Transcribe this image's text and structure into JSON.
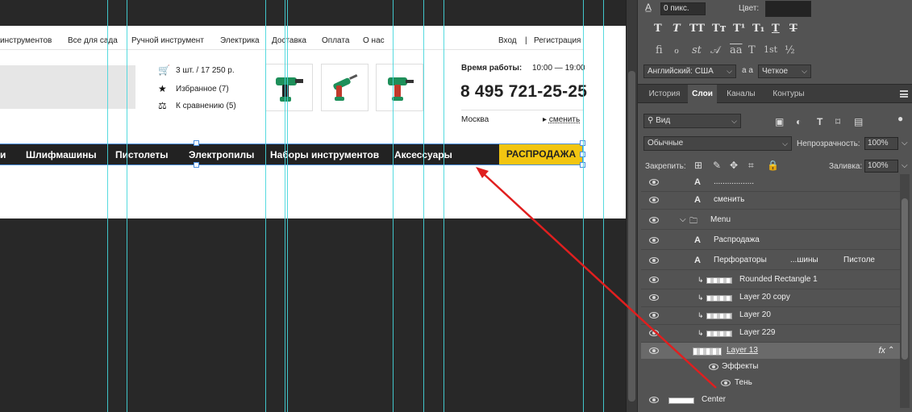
{
  "page": {
    "topnav": [
      "инструментов",
      "Все для сада",
      "Ручной инструмент",
      "Электрика",
      "Доставка",
      "Оплата",
      "О нас"
    ],
    "login": "Вход",
    "login_sep": "|",
    "register": "Регистрация",
    "cart": "3 шт. /  17 250 р.",
    "favorites": "Избранное (7)",
    "compare": "К сравнению (5)",
    "hours_label": "Время работы:",
    "hours_value": "10:00 — 19:00",
    "phone": "8 495 721-25-25",
    "city": "Москва",
    "change_city": "сменить",
    "menu": [
      "и",
      "Шлифмашины",
      "Пистолеты",
      "Электропилы",
      "Наборы инструментов",
      "Аксессуары"
    ],
    "sale": "РАСПРОДАЖА"
  },
  "character_panel": {
    "tracking_value": "0 пикс.",
    "color_label": "Цвет:",
    "text_styles": [
      "T",
      "T",
      "TT",
      "Tт",
      "T¹",
      "T₁",
      "T",
      "T"
    ],
    "opentype": [
      "fi",
      "ℴ",
      "st",
      "𝒜",
      "aa",
      "T",
      "1st",
      "½"
    ],
    "language": "Английский: США",
    "aa_label": "a a",
    "antialias": "Четкое"
  },
  "panel_tabs": [
    "История",
    "Слои",
    "Каналы",
    "Контуры"
  ],
  "active_tab": "Слои",
  "filter_kind": "Вид",
  "blend_mode": "Обычные",
  "opacity_label": "Непрозрачность:",
  "opacity_value": "100%",
  "lock_label": "Закрепить:",
  "fill_label": "Заливка:",
  "fill_value": "100%",
  "layers": [
    {
      "name": "..................",
      "kind": "text"
    },
    {
      "name": "сменить",
      "kind": "text"
    },
    {
      "name": "Menu",
      "kind": "group"
    },
    {
      "name": "Распродажа",
      "kind": "text"
    },
    {
      "name": "Перфораторы",
      "extra1": "...шины",
      "extra2": "Пистоле",
      "kind": "text"
    },
    {
      "name": "Rounded Rectangle 1",
      "kind": "clip"
    },
    {
      "name": "Layer 20 copy",
      "kind": "clip"
    },
    {
      "name": "Layer 20",
      "kind": "clip"
    },
    {
      "name": "Layer 229",
      "kind": "clip"
    },
    {
      "name": "Layer 13",
      "kind": "selected",
      "fx": "fx"
    },
    {
      "name": "Эффекты",
      "kind": "effects"
    },
    {
      "name": "Тень",
      "kind": "effect"
    },
    {
      "name": "Center",
      "kind": "base"
    }
  ],
  "colors": {
    "accent_sale": "#f2c511",
    "menu_bar": "#222222",
    "guide": "#44d6dc",
    "arrow": "#e01f1f"
  }
}
